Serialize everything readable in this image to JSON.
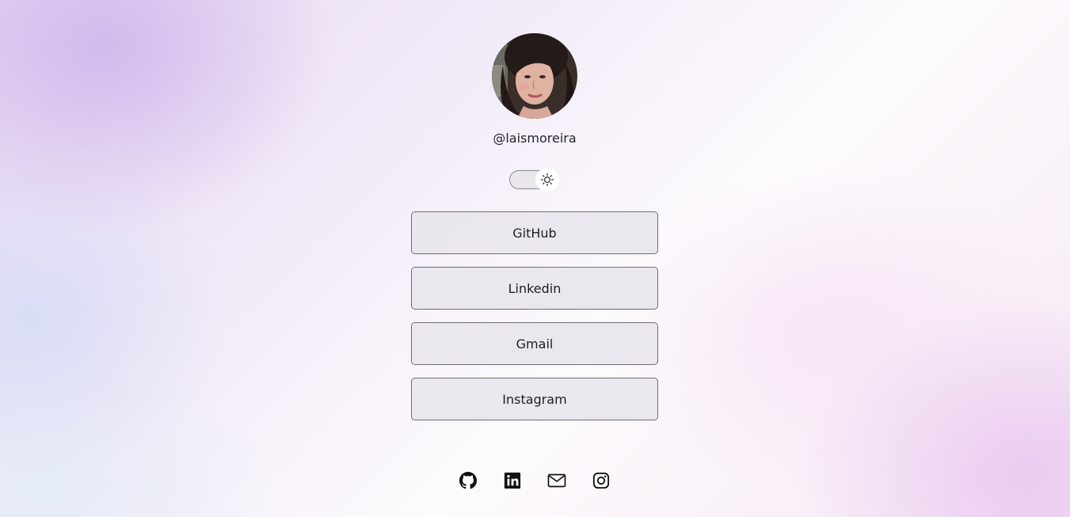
{
  "profile": {
    "handle": "@laismoreira",
    "avatar_icon": "profile-photo"
  },
  "theme_toggle": {
    "icon": "sun-icon",
    "state": "light"
  },
  "links": [
    {
      "label": "GitHub"
    },
    {
      "label": "Linkedin"
    },
    {
      "label": "Gmail"
    },
    {
      "label": "Instagram"
    }
  ],
  "social_icons": [
    "github-icon",
    "linkedin-icon",
    "mail-icon",
    "instagram-icon"
  ],
  "colors": {
    "button_border": "#6e6b74",
    "button_bg": "#e8e5ec",
    "text": "#1e1e24",
    "accent_lilac": "#cdb4ec"
  }
}
